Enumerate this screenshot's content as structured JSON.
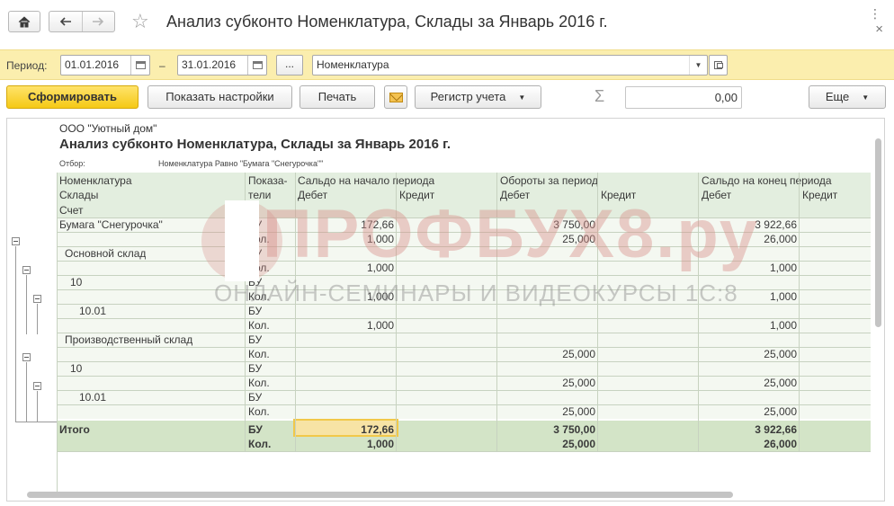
{
  "window": {
    "title": "Анализ субконто Номенклатура, Склады за Январь 2016 г.",
    "more_glyph": "⋮",
    "close_glyph": "×"
  },
  "period": {
    "label": "Период:",
    "from": "01.01.2016",
    "dash": "–",
    "to": "31.01.2016",
    "select_button": "...",
    "subconto_types": "Номенклатура"
  },
  "toolbar": {
    "generate": "Сформировать",
    "show_settings": "Показать настройки",
    "print": "Печать",
    "account_register": "Регистр учета",
    "sigma": "Σ",
    "sum_value": "0,00",
    "more": "Еще"
  },
  "report": {
    "organization": "ООО \"Уютный дом\"",
    "title": "Анализ субконто Номенклатура, Склады за Январь 2016 г.",
    "filter_label": "Отбор:",
    "filter_value": "Номенклатура Равно \"Бумага \"Снегурочка\"\"",
    "header": {
      "col_nomenclature": "Номенклатура",
      "col_warehouses": "Склады",
      "col_account": "Счет",
      "col_indicator_1": "Показа-",
      "col_indicator_2": "тели",
      "opening": "Сальдо на начало периода",
      "turnover": "Обороты за период",
      "closing": "Сальдо на конец периода",
      "debit": "Дебет",
      "credit": "Кредит"
    },
    "rows": [
      {
        "name": "Бумага \"Снегурочка\"",
        "ind": "БУ",
        "open_dt": "172,66",
        "turn_dt": "3 750,00",
        "close_dt": "3 922,66"
      },
      {
        "name": "",
        "ind": "Кол.",
        "open_dt": "1,000",
        "turn_dt": "25,000",
        "close_dt": "26,000"
      },
      {
        "name": "Основной склад",
        "ind": "БУ",
        "open_dt": "",
        "turn_dt": "",
        "close_dt": ""
      },
      {
        "name": "",
        "ind": "Кол.",
        "open_dt": "1,000",
        "turn_dt": "",
        "close_dt": "1,000"
      },
      {
        "name": "10",
        "ind": "БУ",
        "open_dt": "",
        "turn_dt": "",
        "close_dt": ""
      },
      {
        "name": "",
        "ind": "Кол.",
        "open_dt": "1,000",
        "turn_dt": "",
        "close_dt": "1,000"
      },
      {
        "name": "10.01",
        "ind": "БУ",
        "open_dt": "",
        "turn_dt": "",
        "close_dt": ""
      },
      {
        "name": "",
        "ind": "Кол.",
        "open_dt": "1,000",
        "turn_dt": "",
        "close_dt": "1,000"
      },
      {
        "name": "Производственный склад",
        "ind": "БУ",
        "open_dt": "",
        "turn_dt": "",
        "close_dt": ""
      },
      {
        "name": "",
        "ind": "Кол.",
        "open_dt": "",
        "turn_dt": "25,000",
        "close_dt": "25,000"
      },
      {
        "name": "10",
        "ind": "БУ",
        "open_dt": "",
        "turn_dt": "",
        "close_dt": ""
      },
      {
        "name": "",
        "ind": "Кол.",
        "open_dt": "",
        "turn_dt": "25,000",
        "close_dt": "25,000"
      },
      {
        "name": "10.01",
        "ind": "БУ",
        "open_dt": "",
        "turn_dt": "",
        "close_dt": ""
      },
      {
        "name": "",
        "ind": "Кол.",
        "open_dt": "",
        "turn_dt": "25,000",
        "close_dt": "25,000"
      }
    ],
    "total": {
      "label": "Итого",
      "ind_1": "БУ",
      "open_dt_1": "172,66",
      "turn_dt_1": "3 750,00",
      "close_dt_1": "3 922,66",
      "ind_2": "Кол.",
      "open_dt_2": "1,000",
      "turn_dt_2": "25,000",
      "close_dt_2": "26,000"
    }
  },
  "watermark": {
    "main": "ПРОФБУХ8.ру",
    "sub": "ОНЛАЙН-СЕМИНАРЫ И ВИДЕОКУРСЫ 1С:8"
  },
  "colors": {
    "accent_yellow": "#f5c916",
    "period_bar": "#fbeeae",
    "header_green": "#e3eedf",
    "total_green": "#d3e4c7",
    "highlight": "#f1c84a"
  }
}
